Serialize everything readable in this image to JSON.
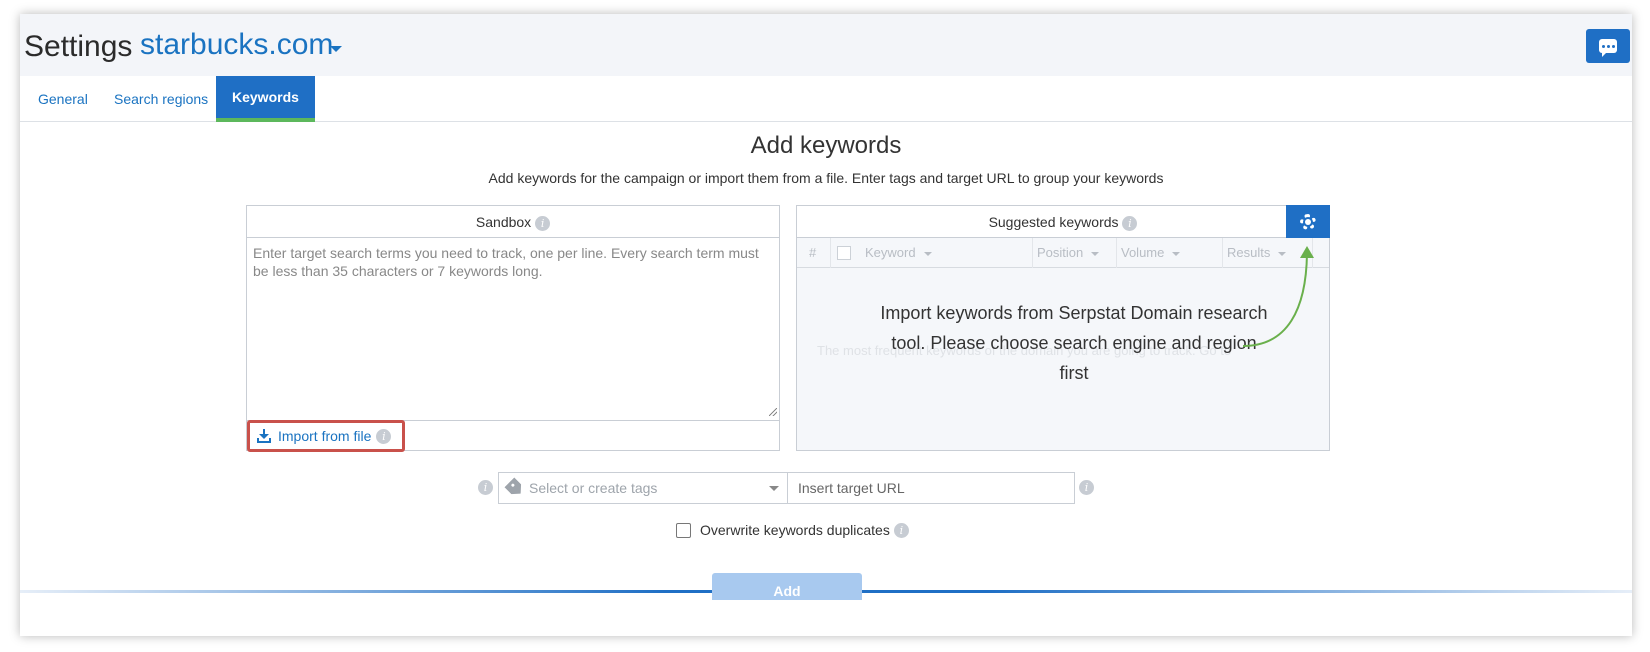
{
  "header": {
    "title": "Settings",
    "domain": "starbucks.com"
  },
  "tabs": [
    {
      "label": "General",
      "active": false
    },
    {
      "label": "Search regions",
      "active": false
    },
    {
      "label": "Keywords",
      "active": true
    }
  ],
  "main": {
    "title": "Add keywords",
    "subtitle": "Add keywords for the campaign or import them from a file. Enter tags and target URL to group your keywords"
  },
  "sandbox": {
    "title": "Sandbox",
    "placeholder": "Enter target search terms you need to track, one per line. Every search term must be less than 35 characters or 7 keywords long.",
    "import_label": "Import from file"
  },
  "suggested": {
    "title": "Suggested keywords",
    "columns": [
      "#",
      "Keyword",
      "Position",
      "Volume",
      "Results"
    ],
    "faded_text": "The most frequent keywords of the domain you are going to track. Go to",
    "callout": "Import keywords from Serpstat Domain research tool. Please choose search engine and region first"
  },
  "form": {
    "tags_placeholder": "Select or create tags",
    "url_placeholder": "Insert target URL",
    "overwrite_label": "Overwrite keywords duplicates",
    "add_label": "Add"
  },
  "colors": {
    "accent": "#1f6fc5",
    "link": "#1a73c1",
    "highlight": "#c9514b",
    "arrow": "#6ab04c"
  },
  "icons": [
    "chat-icon",
    "download-icon",
    "info-icon",
    "gear-icon",
    "tag-icon",
    "caret-down-icon"
  ]
}
